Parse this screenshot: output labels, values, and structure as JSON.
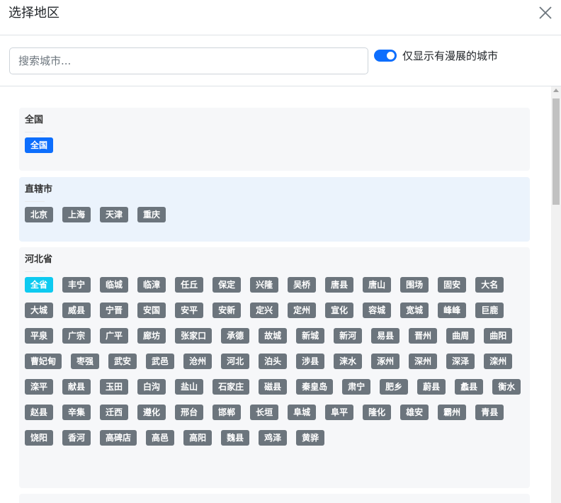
{
  "header": {
    "title": "选择地区"
  },
  "search": {
    "placeholder": "搜索城市..."
  },
  "toggle": {
    "label": "仅显示有漫展的城市",
    "on": true
  },
  "sections": [
    {
      "title": "全国",
      "items": [
        "全国"
      ],
      "active": "全国"
    },
    {
      "title": "直辖市",
      "items": [
        "北京",
        "上海",
        "天津",
        "重庆"
      ]
    },
    {
      "title": "河北省",
      "active": "全省",
      "items": [
        "全省",
        "丰宁",
        "临城",
        "临漳",
        "任丘",
        "保定",
        "兴隆",
        "吴桥",
        "唐县",
        "唐山",
        "围场",
        "固安",
        "大名",
        "大城",
        "威县",
        "宁晋",
        "安国",
        "安平",
        "安新",
        "定兴",
        "定州",
        "宣化",
        "容城",
        "宽城",
        "峰峰",
        "巨鹿",
        "平泉",
        "广宗",
        "广平",
        "廊坊",
        "张家口",
        "承德",
        "故城",
        "新城",
        "新河",
        "易县",
        "晋州",
        "曲周",
        "曲阳",
        "曹妃甸",
        "枣强",
        "武安",
        "武邑",
        "沧州",
        "河北",
        "泊头",
        "涉县",
        "涞水",
        "涿州",
        "深州",
        "深泽",
        "滦州",
        "滦平",
        "献县",
        "玉田",
        "白沟",
        "盐山",
        "石家庄",
        "磁县",
        "秦皇岛",
        "肃宁",
        "肥乡",
        "蔚县",
        "蠡县",
        "衡水",
        "赵县",
        "辛集",
        "迁西",
        "遵化",
        "邢台",
        "邯郸",
        "长垣",
        "阜城",
        "阜平",
        "隆化",
        "雄安",
        "霸州",
        "青县",
        "饶阳",
        "香河",
        "高碑店",
        "高邑",
        "高阳",
        "魏县",
        "鸡泽",
        "黄骅"
      ]
    }
  ]
}
